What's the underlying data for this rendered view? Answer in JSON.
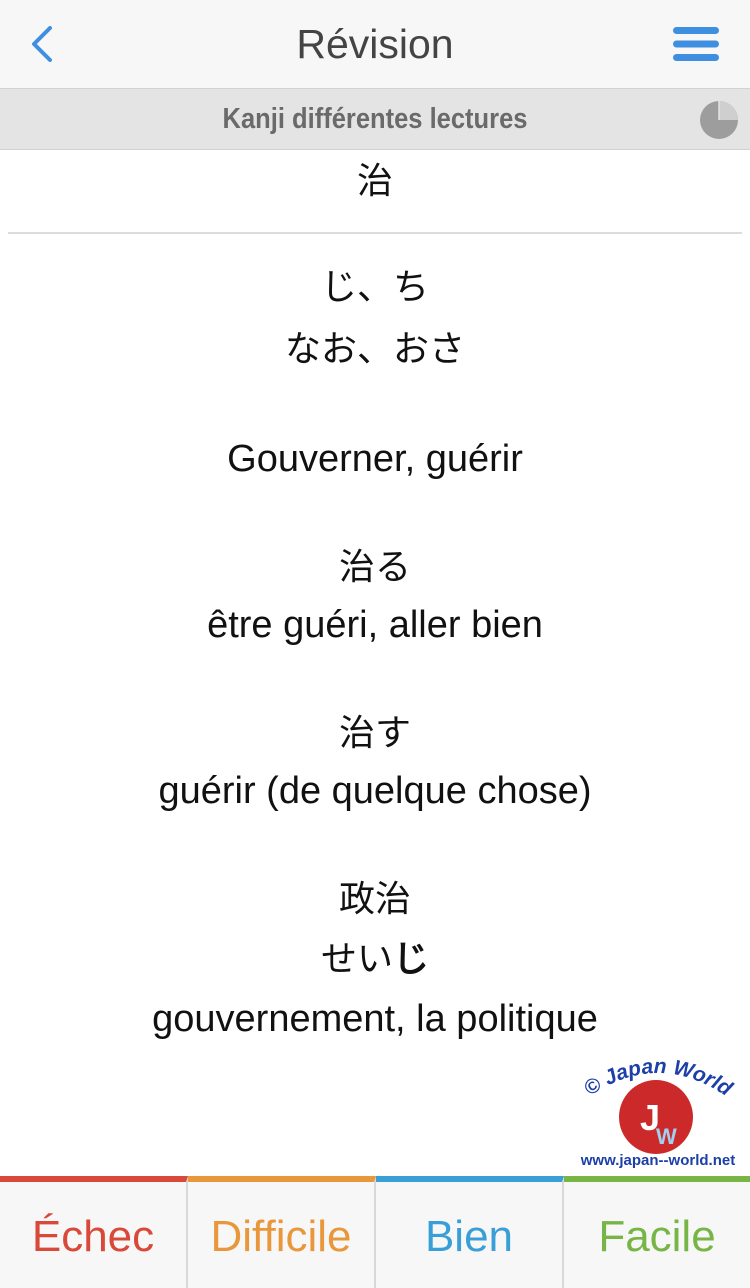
{
  "navbar": {
    "title": "Révision",
    "back_icon": "chevron-left-icon",
    "menu_icon": "hamburger-menu-icon",
    "accent_color": "#3f8fe0"
  },
  "subheader": {
    "title": "Kanji différentes lectures",
    "progress_icon": "progress-pie-icon",
    "progress_fraction": 0.25
  },
  "card": {
    "kanji": "治",
    "onyomi": "じ、ち",
    "kunyomi": "なお、おさ",
    "meaning": "Gouverner, guérir",
    "examples": [
      {
        "word": "治る",
        "meaning": "être guéri, aller bien"
      },
      {
        "word": "治す",
        "meaning": "guérir (de quelque chose)"
      },
      {
        "word": "政治",
        "reading_plain": "せい",
        "reading_bold": "じ",
        "meaning": "gouvernement, la politique"
      }
    ]
  },
  "watermark": {
    "logo_text": "© Japan World",
    "url": "www.japan--world.net",
    "icon": "japan-world-logo-icon"
  },
  "answers": [
    {
      "label": "Échec",
      "color": "#d9493a"
    },
    {
      "label": "Difficile",
      "color": "#e8973b"
    },
    {
      "label": "Bien",
      "color": "#3a9fd6"
    },
    {
      "label": "Facile",
      "color": "#77b646"
    }
  ]
}
